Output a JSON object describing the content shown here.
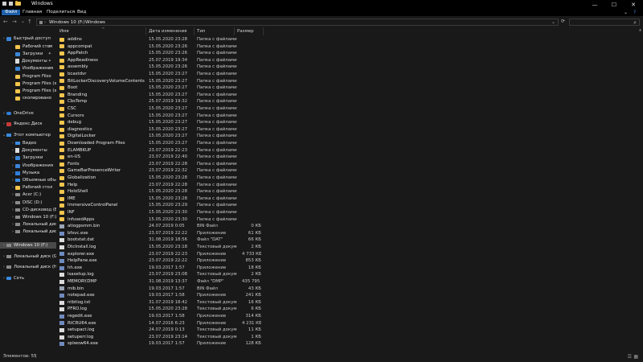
{
  "window": {
    "title": "Windows",
    "minimize": "—",
    "maximize": "☐",
    "close": "✕"
  },
  "ribbon": {
    "tabs": [
      "Файл",
      "Главная",
      "Поделиться",
      "Вид"
    ],
    "expand": "⌄",
    "help": "?"
  },
  "nav": {
    "back": "←",
    "forward": "→",
    "recent": "⌄",
    "up": "↑",
    "breadcrumb_sep1": "›",
    "breadcrumb_1": "Windows 10 (F:)",
    "breadcrumb_sep2": "›",
    "breadcrumb_2": "Windows",
    "dropdown": "⌄",
    "refresh": "⟳",
    "search_icon": "⌕"
  },
  "sidebar": {
    "items": [
      {
        "label": "Быстрый доступ",
        "icon": "star-icon",
        "indent": 0,
        "chev": "›",
        "pin": ""
      },
      {
        "label": "Рабочий стол",
        "icon": "desktop-icon",
        "indent": 1,
        "chev": "",
        "pin": "✦"
      },
      {
        "label": "Загрузки",
        "icon": "download-icon",
        "indent": 1,
        "chev": "",
        "pin": "✦"
      },
      {
        "label": "Документы",
        "icon": "documents-icon",
        "indent": 1,
        "chev": "",
        "pin": "✦"
      },
      {
        "label": "Изображения",
        "icon": "pictures-icon",
        "indent": 1,
        "chev": "",
        "pin": "✦"
      },
      {
        "label": "Program Files",
        "icon": "folder-icon",
        "indent": 1,
        "chev": "",
        "pin": ""
      },
      {
        "label": "Program Files (x86)",
        "icon": "folder-icon",
        "indent": 1,
        "chev": "",
        "pin": ""
      },
      {
        "label": "Program Files (x86)",
        "icon": "folder-icon",
        "indent": 1,
        "chev": "",
        "pin": ""
      },
      {
        "label": "скопировано",
        "icon": "folder-icon",
        "indent": 1,
        "chev": "",
        "pin": ""
      },
      {
        "label": "OneDrive",
        "icon": "onedrive-icon",
        "indent": 0,
        "chev": "›",
        "pin": ""
      },
      {
        "label": "Яндекс.Диск",
        "icon": "yandex-disk-icon",
        "indent": 0,
        "chev": "›",
        "pin": ""
      },
      {
        "label": "Этот компьютер",
        "icon": "computer-icon",
        "indent": 0,
        "chev": "⌄",
        "pin": ""
      },
      {
        "label": "Видео",
        "icon": "video-icon",
        "indent": 1,
        "chev": "›",
        "pin": ""
      },
      {
        "label": "Документы",
        "icon": "documents-icon",
        "indent": 1,
        "chev": "›",
        "pin": ""
      },
      {
        "label": "Загрузки",
        "icon": "download-icon",
        "indent": 1,
        "chev": "›",
        "pin": ""
      },
      {
        "label": "Изображения",
        "icon": "pictures-icon",
        "indent": 1,
        "chev": "›",
        "pin": ""
      },
      {
        "label": "Музыка",
        "icon": "music-icon",
        "indent": 1,
        "chev": "›",
        "pin": ""
      },
      {
        "label": "Объемные объекты",
        "icon": "3d-objects-icon",
        "indent": 1,
        "chev": "›",
        "pin": ""
      },
      {
        "label": "Рабочий стол",
        "icon": "desktop-icon",
        "indent": 1,
        "chev": "›",
        "pin": ""
      },
      {
        "label": "Acer (C:)",
        "icon": "drive-icon",
        "indent": 1,
        "chev": "›",
        "pin": ""
      },
      {
        "label": "DISC (D:)",
        "icon": "drive-icon",
        "indent": 1,
        "chev": "›",
        "pin": ""
      },
      {
        "label": "CD-дисковод (E:)",
        "icon": "cd-drive-icon",
        "indent": 1,
        "chev": "›",
        "pin": ""
      },
      {
        "label": "Windows 10 (F:)",
        "icon": "drive-icon",
        "indent": 1,
        "chev": "›",
        "pin": ""
      },
      {
        "label": "Локальный диск (G",
        "icon": "drive-icon",
        "indent": 1,
        "chev": "›",
        "pin": ""
      },
      {
        "label": "Локальный диск (H",
        "icon": "drive-icon",
        "indent": 1,
        "chev": "›",
        "pin": ""
      },
      {
        "label": "Windows 10 (F:)",
        "icon": "drive-icon",
        "indent": 0,
        "chev": "›",
        "pin": "",
        "selected": true
      },
      {
        "label": "Локальный диск (G:)",
        "icon": "drive-icon",
        "indent": 0,
        "chev": "›",
        "pin": ""
      },
      {
        "label": "Локальный диск (H:)",
        "icon": "drive-icon",
        "indent": 0,
        "chev": "›",
        "pin": ""
      },
      {
        "label": "Сеть",
        "icon": "network-icon",
        "indent": 0,
        "chev": "›",
        "pin": ""
      }
    ]
  },
  "columns": {
    "name": "Имя",
    "sort": "^",
    "date": "Дата изменения",
    "type": "Тип",
    "size": "Размер"
  },
  "files": [
    {
      "name": "addins",
      "date": "15.05.2020 23:28",
      "type": "Папка с файлами",
      "size": "",
      "icon": "folder-icon"
    },
    {
      "name": "appcompat",
      "date": "15.05.2020 23:26",
      "type": "Папка с файлами",
      "size": "",
      "icon": "folder-icon"
    },
    {
      "name": "AppPatch",
      "date": "15.05.2020 23:26",
      "type": "Папка с файлами",
      "size": "",
      "icon": "folder-icon"
    },
    {
      "name": "AppReadiness",
      "date": "25.07.2019 19:34",
      "type": "Папка с файлами",
      "size": "",
      "icon": "folder-icon"
    },
    {
      "name": "assembly",
      "date": "15.05.2020 23:26",
      "type": "Папка с файлами",
      "size": "",
      "icon": "folder-icon"
    },
    {
      "name": "bcastdvr",
      "date": "15.05.2020 23:27",
      "type": "Папка с файлами",
      "size": "",
      "icon": "folder-icon"
    },
    {
      "name": "BitLockerDiscoveryVolumeContents",
      "date": "15.05.2020 23:27",
      "type": "Папка с файлами",
      "size": "",
      "icon": "folder-icon"
    },
    {
      "name": "Boot",
      "date": "15.05.2020 23:27",
      "type": "Папка с файлами",
      "size": "",
      "icon": "folder-icon"
    },
    {
      "name": "Branding",
      "date": "15.05.2020 23:27",
      "type": "Папка с файлами",
      "size": "",
      "icon": "folder-icon"
    },
    {
      "name": "CbsTemp",
      "date": "25.07.2019 19:32",
      "type": "Папка с файлами",
      "size": "",
      "icon": "folder-icon"
    },
    {
      "name": "CSC",
      "date": "15.05.2020 23:27",
      "type": "Папка с файлами",
      "size": "",
      "icon": "folder-icon"
    },
    {
      "name": "Cursors",
      "date": "15.05.2020 23:27",
      "type": "Папка с файлами",
      "size": "",
      "icon": "folder-icon"
    },
    {
      "name": "debug",
      "date": "15.05.2020 23:27",
      "type": "Папка с файлами",
      "size": "",
      "icon": "folder-icon"
    },
    {
      "name": "diagnostics",
      "date": "15.05.2020 23:27",
      "type": "Папка с файлами",
      "size": "",
      "icon": "folder-icon"
    },
    {
      "name": "DigitalLocker",
      "date": "15.05.2020 23:27",
      "type": "Папка с файлами",
      "size": "",
      "icon": "folder-icon"
    },
    {
      "name": "Downloaded Program Files",
      "date": "15.05.2020 23:27",
      "type": "Папка с файлами",
      "size": "",
      "icon": "folder-icon"
    },
    {
      "name": "ELAMBKUP",
      "date": "23.07.2019 22:23",
      "type": "Папка с файлами",
      "size": "",
      "icon": "folder-icon"
    },
    {
      "name": "en-US",
      "date": "23.07.2019 22:40",
      "type": "Папка с файлами",
      "size": "",
      "icon": "folder-icon"
    },
    {
      "name": "Fonts",
      "date": "23.07.2019 22:28",
      "type": "Папка с файлами",
      "size": "",
      "icon": "folder-icon"
    },
    {
      "name": "GameBarPresenceWriter",
      "date": "23.07.2019 22:32",
      "type": "Папка с файлами",
      "size": "",
      "icon": "folder-icon"
    },
    {
      "name": "Globalization",
      "date": "15.05.2020 23:28",
      "type": "Папка с файлами",
      "size": "",
      "icon": "folder-icon"
    },
    {
      "name": "Help",
      "date": "23.07.2019 22:28",
      "type": "Папка с файлами",
      "size": "",
      "icon": "folder-icon"
    },
    {
      "name": "HoloShell",
      "date": "15.05.2020 23:28",
      "type": "Папка с файлами",
      "size": "",
      "icon": "folder-icon"
    },
    {
      "name": "IME",
      "date": "15.05.2020 23:28",
      "type": "Папка с файлами",
      "size": "",
      "icon": "folder-icon"
    },
    {
      "name": "ImmersiveControlPanel",
      "date": "15.05.2020 23:29",
      "type": "Папка с файлами",
      "size": "",
      "icon": "folder-icon"
    },
    {
      "name": "INF",
      "date": "15.05.2020 23:30",
      "type": "Папка с файлами",
      "size": "",
      "icon": "folder-icon"
    },
    {
      "name": "InfusedApps",
      "date": "15.05.2020 23:30",
      "type": "Папка с файлами",
      "size": "",
      "icon": "folder-icon"
    },
    {
      "name": "atiogpsmm.bin",
      "date": "24.07.2019 0:05",
      "type": "BIN Файл",
      "size": "0 КБ",
      "icon": "bin-file-icon"
    },
    {
      "name": "bfsvc.exe",
      "date": "23.07.2019 22:22",
      "type": "Приложение",
      "size": "61 КБ",
      "icon": "app-icon"
    },
    {
      "name": "bootstat.dat",
      "date": "31.08.2019 18:56",
      "type": "Файл \"DAT\"",
      "size": "66 КБ",
      "icon": "file-icon"
    },
    {
      "name": "DtcInstall.log",
      "date": "15.05.2020 23:18",
      "type": "Текстовый докуме...",
      "size": "2 КБ",
      "icon": "file-icon"
    },
    {
      "name": "explorer.exe",
      "date": "23.07.2019 22:23",
      "type": "Приложение",
      "size": "4 733 КБ",
      "icon": "app-icon"
    },
    {
      "name": "HelpPane.exe",
      "date": "23.07.2019 22:22",
      "type": "Приложение",
      "size": "853 КБ",
      "icon": "app-icon"
    },
    {
      "name": "hh.exe",
      "date": "19.03.2017 1:57",
      "type": "Приложение",
      "size": "18 КБ",
      "icon": "app-icon"
    },
    {
      "name": "lsasetup.log",
      "date": "23.07.2019 23:08",
      "type": "Текстовый докуме...",
      "size": "2 КБ",
      "icon": "file-icon"
    },
    {
      "name": "MEMORY.DMP",
      "date": "31.08.2019 13:37",
      "type": "Файл \"DMP\"",
      "size": "435 795 КБ",
      "icon": "file-icon"
    },
    {
      "name": "mib.bin",
      "date": "19.03.2017 1:57",
      "type": "BIN Файл",
      "size": "43 КБ",
      "icon": "bin-file-icon"
    },
    {
      "name": "notepad.exe",
      "date": "19.03.2017 1:58",
      "type": "Приложение",
      "size": "241 КБ",
      "icon": "app-icon"
    },
    {
      "name": "ntbtlog.txt",
      "date": "31.07.2019 18:42",
      "type": "Текстовый докуме...",
      "size": "16 КБ",
      "icon": "file-icon"
    },
    {
      "name": "PFRO.log",
      "date": "15.05.2020 23:28",
      "type": "Текстовый докуме...",
      "size": "6 КБ",
      "icon": "file-icon"
    },
    {
      "name": "regedit.exe",
      "date": "19.03.2017 1:58",
      "type": "Приложение",
      "size": "314 КБ",
      "icon": "app-icon"
    },
    {
      "name": "RtCRU64.exe",
      "date": "14.07.2016 6:23",
      "type": "Приложение",
      "size": "4 231 КБ",
      "icon": "app-icon"
    },
    {
      "name": "setupact.log",
      "date": "24.07.2019 0:13",
      "type": "Текстовый докуме...",
      "size": "11 КБ",
      "icon": "file-icon"
    },
    {
      "name": "setuperr.log",
      "date": "23.07.2019 23:14",
      "type": "Текстовый докуме...",
      "size": "1 КБ",
      "icon": "file-icon"
    },
    {
      "name": "splwow64.exe",
      "date": "19.03.2017 1:57",
      "type": "Приложение",
      "size": "128 КБ",
      "icon": "app-icon"
    }
  ],
  "status": {
    "count": "Элементов: 55",
    "sep": "|",
    "view_details": "☰",
    "view_tiles": "▦"
  },
  "scroll_up": "▲"
}
